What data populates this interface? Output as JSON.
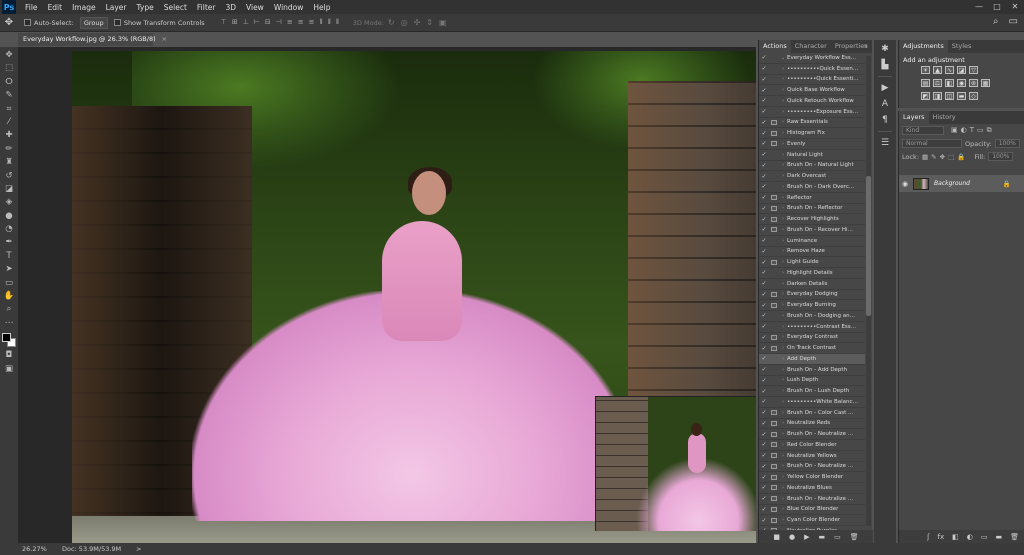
{
  "app": {
    "logo": "Ps"
  },
  "menu": [
    "File",
    "Edit",
    "Image",
    "Layer",
    "Type",
    "Select",
    "Filter",
    "3D",
    "View",
    "Window",
    "Help"
  ],
  "window_controls": [
    "—",
    "□",
    "✕"
  ],
  "options": {
    "move_tool_icon": "move-icon",
    "auto_select_label": "Auto-Select:",
    "auto_select_value": "Group",
    "show_transform_label": "Show Transform Controls",
    "three_d_label": "3D Mode:"
  },
  "document": {
    "tab_title": "Everyday Workflow.jpg @ 26.3% (RGB/8)",
    "tab_close": "×"
  },
  "status": {
    "zoom": "26.27%",
    "doc_size": "Doc: 53.9M/53.9M",
    "arrow": ">"
  },
  "actions_panel": {
    "tabs": [
      "Actions",
      "Character",
      "Properties"
    ],
    "menu_glyph": "»",
    "items": [
      {
        "label": "Everyday Workflow Ess...",
        "check": true,
        "dialog": false,
        "sel": false
      },
      {
        "label": "••••••••••Quick Essential...",
        "check": true,
        "dialog": false,
        "sel": false
      },
      {
        "label": "•••••••••Quick Essenti...",
        "check": true,
        "dialog": false,
        "sel": false
      },
      {
        "label": "Quick Base Workflow",
        "check": true,
        "dialog": false,
        "sel": false
      },
      {
        "label": "Quick Retouch Workflow",
        "check": true,
        "dialog": false,
        "sel": false
      },
      {
        "label": "•••••••••Exposure Esse...",
        "check": true,
        "dialog": false,
        "sel": false
      },
      {
        "label": "Raw Essentials",
        "check": true,
        "dialog": true,
        "sel": false
      },
      {
        "label": "Histogram Fix",
        "check": true,
        "dialog": true,
        "sel": false
      },
      {
        "label": "Evenly",
        "check": true,
        "dialog": true,
        "sel": false
      },
      {
        "label": "Natural Light",
        "check": true,
        "dialog": false,
        "sel": false
      },
      {
        "label": "Brush On - Natural Light",
        "check": true,
        "dialog": false,
        "sel": false
      },
      {
        "label": "Dark Overcast",
        "check": true,
        "dialog": false,
        "sel": false
      },
      {
        "label": "Brush On - Dark Overc...",
        "check": true,
        "dialog": false,
        "sel": false
      },
      {
        "label": "Reflector",
        "check": true,
        "dialog": true,
        "sel": false
      },
      {
        "label": "Brush On - Reflector",
        "check": true,
        "dialog": true,
        "sel": false
      },
      {
        "label": "Recover Highlights",
        "check": true,
        "dialog": true,
        "sel": false
      },
      {
        "label": "Brush On - Recover Hi...",
        "check": true,
        "dialog": true,
        "sel": false
      },
      {
        "label": "Luminance",
        "check": true,
        "dialog": false,
        "sel": false
      },
      {
        "label": "Remove Haze",
        "check": true,
        "dialog": false,
        "sel": false
      },
      {
        "label": "Light Guide",
        "check": true,
        "dialog": true,
        "sel": false
      },
      {
        "label": "Highlight Details",
        "check": true,
        "dialog": false,
        "sel": false
      },
      {
        "label": "Darken Details",
        "check": true,
        "dialog": false,
        "sel": false
      },
      {
        "label": "Everyday Dodging",
        "check": true,
        "dialog": true,
        "sel": false
      },
      {
        "label": "Everyday Burning",
        "check": true,
        "dialog": true,
        "sel": false
      },
      {
        "label": "Brush On - Dodging an...",
        "check": true,
        "dialog": false,
        "sel": false
      },
      {
        "label": "•••••••••Contrast Essen...",
        "check": true,
        "dialog": false,
        "sel": false
      },
      {
        "label": "Everyday Contrast",
        "check": true,
        "dialog": true,
        "sel": false
      },
      {
        "label": "On Track Contrast",
        "check": true,
        "dialog": true,
        "sel": false
      },
      {
        "label": "Add Depth",
        "check": true,
        "dialog": false,
        "sel": true
      },
      {
        "label": "Brush On - Add Depth",
        "check": true,
        "dialog": false,
        "sel": false
      },
      {
        "label": "Lush Depth",
        "check": true,
        "dialog": false,
        "sel": false
      },
      {
        "label": "Brush On - Lush Depth",
        "check": true,
        "dialog": false,
        "sel": false
      },
      {
        "label": "•••••••••White Balance ...",
        "check": true,
        "dialog": false,
        "sel": false
      },
      {
        "label": "Brush On - Color Cast ...",
        "check": true,
        "dialog": true,
        "sel": false
      },
      {
        "label": "Neutralize Reds",
        "check": true,
        "dialog": true,
        "sel": false
      },
      {
        "label": "Brush On - Neutralize ...",
        "check": true,
        "dialog": true,
        "sel": false
      },
      {
        "label": "Red Color Blender",
        "check": true,
        "dialog": true,
        "sel": false
      },
      {
        "label": "Neutralize Yellows",
        "check": true,
        "dialog": true,
        "sel": false
      },
      {
        "label": "Brush On - Neutralize ...",
        "check": true,
        "dialog": true,
        "sel": false
      },
      {
        "label": "Yellow Color Blender",
        "check": true,
        "dialog": true,
        "sel": false
      },
      {
        "label": "Neutralize Blues",
        "check": true,
        "dialog": true,
        "sel": false
      },
      {
        "label": "Brush On - Neutralize ...",
        "check": true,
        "dialog": true,
        "sel": false
      },
      {
        "label": "Blue Color Blender",
        "check": true,
        "dialog": true,
        "sel": false
      },
      {
        "label": "Cyan Color Blender",
        "check": true,
        "dialog": true,
        "sel": false
      },
      {
        "label": "Neutralize Purples",
        "check": true,
        "dialog": true,
        "sel": false
      }
    ],
    "bottom_icons": [
      "■",
      "●",
      "▶",
      "▬",
      "▭",
      "🗑"
    ]
  },
  "adjustments_panel": {
    "tabs": [
      "Adjustments",
      "Styles"
    ],
    "title": "Add an adjustment"
  },
  "layers_panel": {
    "tabs": [
      "Layers",
      "History"
    ],
    "kind": "Kind",
    "blend_mode": "Normal",
    "opacity_label": "Opacity:",
    "opacity_value": "100%",
    "lock_label": "Lock:",
    "fill_label": "Fill:",
    "fill_value": "100%",
    "layer_name": "Background",
    "bottom_icons": [
      "ʃ",
      "fx",
      "◧",
      "◐",
      "▭",
      "▬",
      "🗑"
    ]
  },
  "colors": {
    "fg": "#000000",
    "bg": "#ffffff",
    "accent": "#31a8ff"
  }
}
